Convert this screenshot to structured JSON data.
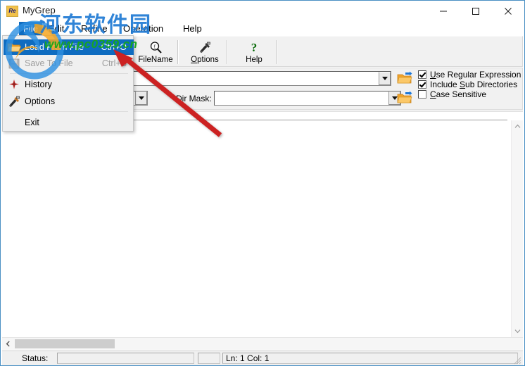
{
  "window": {
    "title": "MyGrep",
    "icon_name": "app-icon",
    "icon_text": "Re",
    "controls": {
      "minimize": "minimize",
      "maximize": "maximize",
      "close": "close"
    }
  },
  "menubar": {
    "items": [
      {
        "label": "File",
        "active": true
      },
      {
        "label": "Edit",
        "active": false
      },
      {
        "label": "Refine",
        "active": false
      },
      {
        "label": "Operation",
        "active": false
      },
      {
        "label": "Help",
        "active": false
      }
    ]
  },
  "file_menu": {
    "items": [
      {
        "label": "Load From File",
        "shortcut": "Ctrl+O",
        "icon": "open-folder-icon",
        "selected": true,
        "disabled": false
      },
      {
        "label": "Save To File",
        "shortcut": "Ctrl+S",
        "icon": "save-disk-icon",
        "selected": false,
        "disabled": true
      },
      {
        "label": "History",
        "shortcut": "",
        "icon": "history-icon",
        "selected": false,
        "disabled": false
      },
      {
        "label": "Options",
        "shortcut": "",
        "icon": "tools-icon",
        "selected": false,
        "disabled": false
      },
      {
        "label": "Exit",
        "shortcut": "",
        "icon": "",
        "selected": false,
        "disabled": false
      }
    ]
  },
  "toolbar": {
    "buttons": [
      {
        "label": "FileName",
        "icon": "magnifier-icon",
        "accel": "F"
      },
      {
        "label": "Options",
        "icon": "tools-icon",
        "accel": "O"
      },
      {
        "label": "Help",
        "icon": "question-mark-icon",
        "accel": ""
      }
    ]
  },
  "criteria": {
    "find_field": {
      "value": "",
      "placeholder": ""
    },
    "mask_field": {
      "value": "",
      "placeholder": ""
    },
    "dir_mask_label": "Dir Mask:",
    "dir_field": {
      "value": "",
      "placeholder": ""
    },
    "browse_button_1": "browse-folder-button",
    "browse_button_2": "browse-folder-button",
    "checkboxes": [
      {
        "label": "Use Regular Expression",
        "checked": true,
        "accel": "U"
      },
      {
        "label": "Include Sub Directories",
        "checked": true,
        "accel": "S"
      },
      {
        "label": "Case Sensitive",
        "checked": false,
        "accel": "C"
      }
    ]
  },
  "results": {
    "content": ""
  },
  "statusbar": {
    "status_label": "Status:",
    "status_value": "",
    "extra_value": "",
    "ln_col": "Ln: 1   Col: 1"
  },
  "watermark": {
    "site_name": "河东软件园",
    "site_url": "www.pc0359.cn"
  },
  "colors": {
    "accent": "#0f6cc0",
    "window_border": "#4a90c4",
    "toolbar_bg": "#f1f1f1",
    "annotation": "#cc2020",
    "watermark_blue": "#1f7ad4",
    "watermark_green": "#17a81a"
  }
}
